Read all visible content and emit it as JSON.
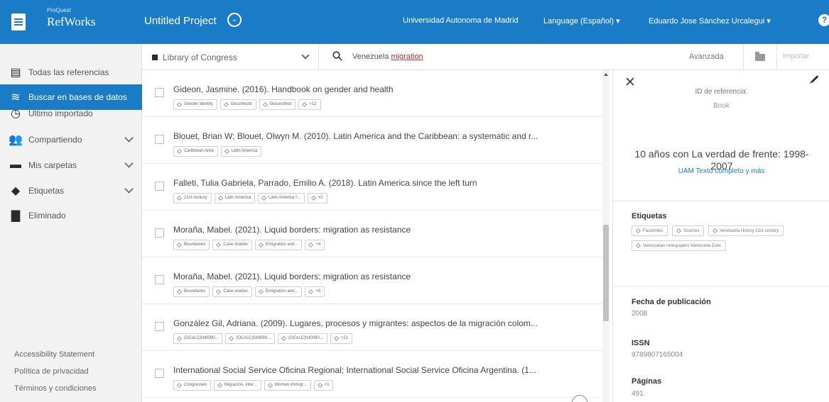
{
  "header": {
    "brand_small": "ProQuest",
    "brand_name": "RefWorks",
    "project_title": "Untitled Project",
    "institution": "Universidad Autonoma de Madrid",
    "language": "Language (Español) ▾",
    "user": "Eduardo Jose Sánchez Urcalegui ▾",
    "help": "?"
  },
  "sidebar": {
    "items": [
      {
        "label": "Todas las referencias",
        "icon": "document-icon"
      },
      {
        "label": "Buscar en bases de datos",
        "icon": "database-icon",
        "active": true
      },
      {
        "label": "Último importado",
        "icon": "clock-icon"
      },
      {
        "label": "Compartiendo",
        "icon": "users-icon",
        "expandable": true
      },
      {
        "label": "Mis carpetas",
        "icon": "folder-icon",
        "expandable": true
      },
      {
        "label": "Etiquetas",
        "icon": "tag-icon",
        "expandable": true
      },
      {
        "label": "Eliminado",
        "icon": "trash-icon"
      }
    ],
    "footer": [
      "Accessibility Statement",
      "Política de privacidad",
      "Términos y condiciones"
    ]
  },
  "search": {
    "database": "Library of Congress",
    "query_plain": "Venezuela ",
    "query_highlight": "migration",
    "advanced": "Avanzada",
    "import": "Importar"
  },
  "results": [
    {
      "title": "Gideon, Jasmine. (2016). Handbook on gender and health",
      "tags": [
        "Gender identity",
        "Geschlecht",
        "Gesundheit",
        "+12"
      ]
    },
    {
      "title": "Blouet, Brian W; Blouet, Olwyn M. (2010). Latin America and the Caribbean: a systematic and r...",
      "tags": [
        "Caribbean Area",
        "Latin America"
      ]
    },
    {
      "title": "Falleti, Tulia Gabriela, Parrado, Emilio A. (2018). Latin America since the left turn",
      "tags": [
        "21st century",
        "Latin America",
        "Latin America f...",
        "+2"
      ]
    },
    {
      "title": "Moraña, Mabel. (2021). Liquid borders: migration as resistance",
      "tags": [
        "Boundaries",
        "Case studies",
        "Emigration and...",
        "+4"
      ]
    },
    {
      "title": "Moraña, Mabel. (2021). Liquid borders: migration as resistance",
      "tags": [
        "Boundaries",
        "Case studies",
        "Emigration and...",
        "+4"
      ]
    },
    {
      "title": "González Gil, Adriana. (2009). Lugares, procesos y migrantes: aspectos de la migración colom...",
      "tags": [
        "(DCoLC)fst0090...",
        "(OCoLC)fst0090...",
        "(OCoLC)fst0090...",
        "+21"
      ]
    },
    {
      "title": "International Social Service Oficina Regional; International Social Service Oficina Argentina. (1...",
      "tags": [
        "Congresses",
        "Migración, inter...",
        "Women immigr...",
        "+1"
      ]
    }
  ],
  "detail": {
    "ref_id_label": "ID de referencia:",
    "ref_type": "Book",
    "title": "10 años con La verdad de frente: 1998-2007",
    "fulltext_link": "UAM Texto completo y más",
    "tags_label": "Etiquetas",
    "tags": [
      "Facsimiles",
      "Sources",
      "Venezuela History 21st century",
      "Venezuelan newspapers Venezuela Zulia"
    ],
    "pub_date_label": "Fecha de publicación",
    "pub_date": "2008",
    "issn_label": "ISSN",
    "issn": "9789807165004",
    "pages_label": "Páginas",
    "pages": "491"
  }
}
